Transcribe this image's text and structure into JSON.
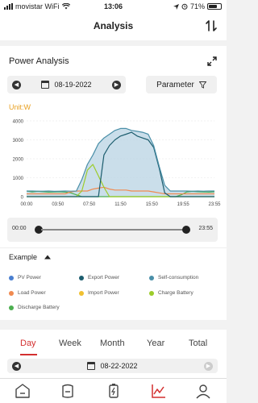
{
  "status_bar": {
    "carrier": "movistar WiFi",
    "time": "13:06",
    "battery": "71%",
    "battery_level": 0.71
  },
  "header": {
    "title": "Analysis",
    "sort_icon": "sort-arrows-icon"
  },
  "power_analysis": {
    "title": "Power Analysis",
    "expand_icon": "expand-icon",
    "date": "08-19-2022",
    "parameter_label": "Parameter",
    "filter_icon": "filter-icon",
    "unit_label": "Unit:W"
  },
  "chart_data": {
    "type": "line",
    "x": [
      "00:00",
      "01:00",
      "02:00",
      "03:00",
      "04:00",
      "05:00",
      "06:00",
      "07:00",
      "08:00",
      "09:00",
      "10:00",
      "10:30",
      "11:00",
      "11:30",
      "12:00",
      "12:30",
      "13:00",
      "13:30",
      "14:00",
      "14:30",
      "15:00",
      "15:30",
      "16:00",
      "16:30",
      "17:00",
      "17:30",
      "18:00",
      "18:30",
      "19:00",
      "19:30",
      "20:00",
      "21:00",
      "22:00",
      "23:00",
      "23:55"
    ],
    "x_tick_labels": [
      "00:00",
      "03:50",
      "07:50",
      "11:50",
      "15:50",
      "19:55",
      "23:55"
    ],
    "y_tick_labels": [
      "0",
      "1000",
      "2000",
      "3000",
      "4000"
    ],
    "ylim": [
      0,
      4000
    ],
    "series": [
      {
        "name": "Self-consumption",
        "color": "#4a8fa8",
        "values": [
          300,
          300,
          290,
          290,
          300,
          280,
          290,
          300,
          290,
          300,
          900,
          1700,
          2200,
          2800,
          3100,
          3300,
          3500,
          3600,
          3600,
          3500,
          3450,
          3400,
          3300,
          2700,
          1600,
          600,
          300,
          300,
          300,
          300,
          290,
          300,
          290,
          300,
          300
        ]
      },
      {
        "name": "Export Power",
        "color": "#1c5d6e",
        "values": [
          0,
          0,
          0,
          0,
          0,
          0,
          0,
          0,
          0,
          0,
          0,
          0,
          0,
          0,
          2200,
          2700,
          3000,
          3200,
          3300,
          3400,
          3200,
          3100,
          3000,
          2600,
          1500,
          200,
          0,
          0,
          0,
          0,
          0,
          0,
          0,
          0,
          0
        ]
      },
      {
        "name": "Charge Battery",
        "color": "#9ccc2a",
        "values": [
          0,
          0,
          0,
          0,
          0,
          0,
          0,
          0,
          0,
          0,
          300,
          1400,
          1700,
          1100,
          500,
          0,
          0,
          0,
          0,
          0,
          0,
          0,
          0,
          0,
          0,
          0,
          0,
          0,
          0,
          0,
          0,
          0,
          0,
          0,
          0
        ]
      },
      {
        "name": "Load Power",
        "color": "#f08a50",
        "values": [
          150,
          150,
          150,
          150,
          150,
          150,
          150,
          150,
          250,
          300,
          300,
          300,
          400,
          450,
          500,
          400,
          350,
          350,
          350,
          300,
          300,
          300,
          300,
          250,
          200,
          150,
          150,
          150,
          150,
          150,
          150,
          150,
          150,
          150,
          150
        ]
      },
      {
        "name": "Discharge Battery",
        "color": "#4caf50",
        "values": [
          300,
          250,
          280,
          260,
          240,
          250,
          260,
          240,
          200,
          100,
          0,
          0,
          0,
          0,
          0,
          0,
          0,
          0,
          0,
          0,
          0,
          0,
          0,
          0,
          0,
          0,
          0,
          0,
          100,
          250,
          280,
          260,
          250,
          240,
          260
        ]
      }
    ]
  },
  "time_slider": {
    "start": "00:00",
    "end": "23:55"
  },
  "example": {
    "label": "Example",
    "legend": [
      {
        "label": "PV Power",
        "color": "#4a7fd0"
      },
      {
        "label": "Export Power",
        "color": "#1c5d6e"
      },
      {
        "label": "Self-consumption",
        "color": "#4a8fa8"
      },
      {
        "label": "Load Power",
        "color": "#f08a50"
      },
      {
        "label": "Import Power",
        "color": "#f0c030"
      },
      {
        "label": "Charge Battery",
        "color": "#9ccc2a"
      },
      {
        "label": "Discharge Battery",
        "color": "#4caf50"
      }
    ]
  },
  "period_tabs": {
    "items": [
      "Day",
      "Week",
      "Month",
      "Year",
      "Total"
    ],
    "active": "Day",
    "date": "08-22-2022"
  },
  "bottom_nav": [
    "home-icon",
    "device-icon",
    "battery-icon",
    "analysis-icon",
    "profile-icon"
  ]
}
